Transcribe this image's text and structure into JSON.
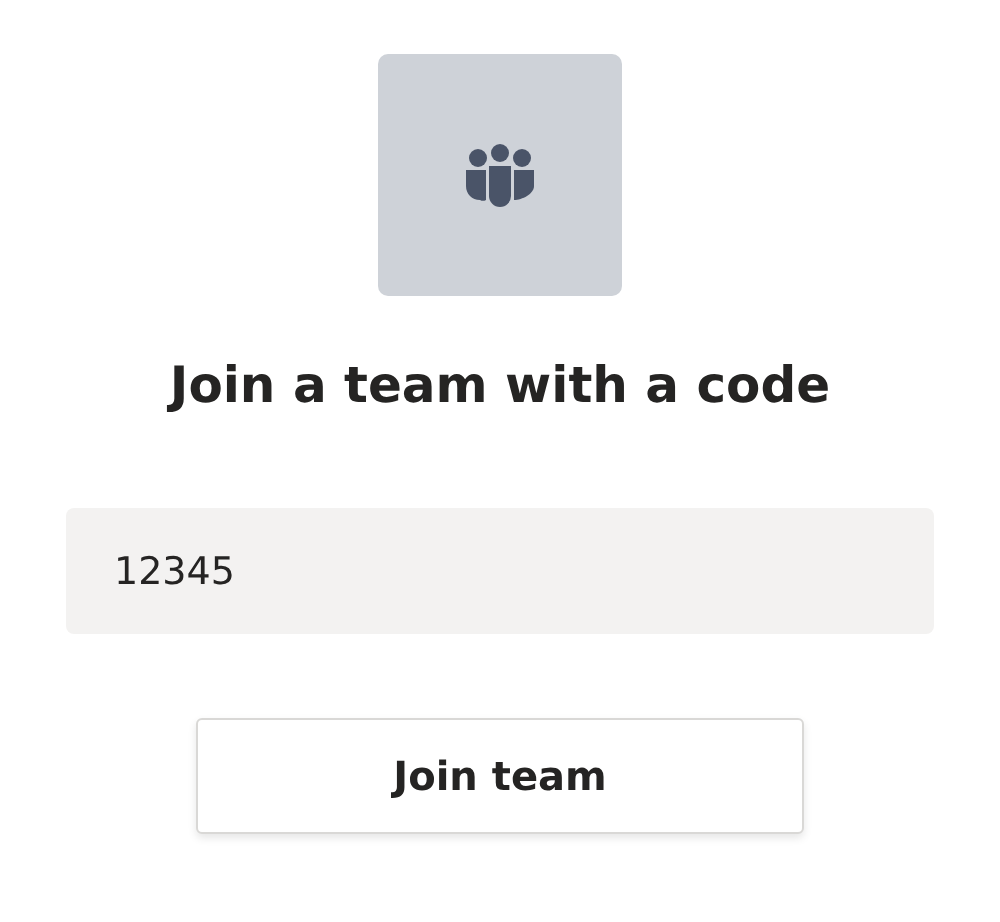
{
  "heading": "Join a team with a code",
  "code_field": {
    "value": "12345"
  },
  "buttons": [
    "Join team"
  ]
}
